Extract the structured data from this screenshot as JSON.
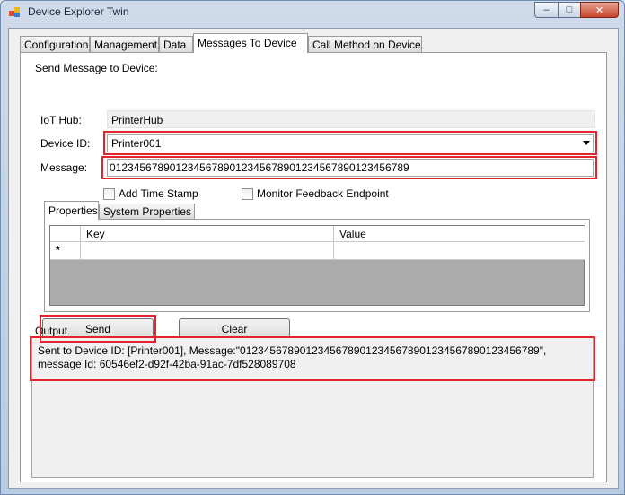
{
  "window": {
    "title": "Device Explorer Twin"
  },
  "tabs": [
    "Configuration",
    "Management",
    "Data",
    "Messages To Device",
    "Call Method on Device"
  ],
  "section_label": "Send Message to Device:",
  "fields": {
    "iot_hub_label": "IoT Hub:",
    "iot_hub_value": "PrinterHub",
    "device_id_label": "Device ID:",
    "device_id_value": "Printer001",
    "message_label": "Message:",
    "message_value": "0123456789012345678901234567890123456789012345678​9"
  },
  "checkboxes": {
    "add_time_stamp": "Add Time Stamp",
    "monitor_feedback": "Monitor Feedback Endpoint"
  },
  "properties": {
    "tabs": [
      "Properties",
      "System Properties"
    ],
    "columns": [
      "Key",
      "Value"
    ],
    "new_row_marker": "*"
  },
  "buttons": {
    "send": "Send",
    "clear": "Clear"
  },
  "output": {
    "label": "Output",
    "text": "Sent to Device ID: [Printer001], Message:\"0123456789012345678901234567890123456789012345678​9\", message Id: 60546ef2-d92f-42ba-91ac-7df528089708"
  },
  "accent_colors": {
    "highlight": "#e2242c"
  }
}
